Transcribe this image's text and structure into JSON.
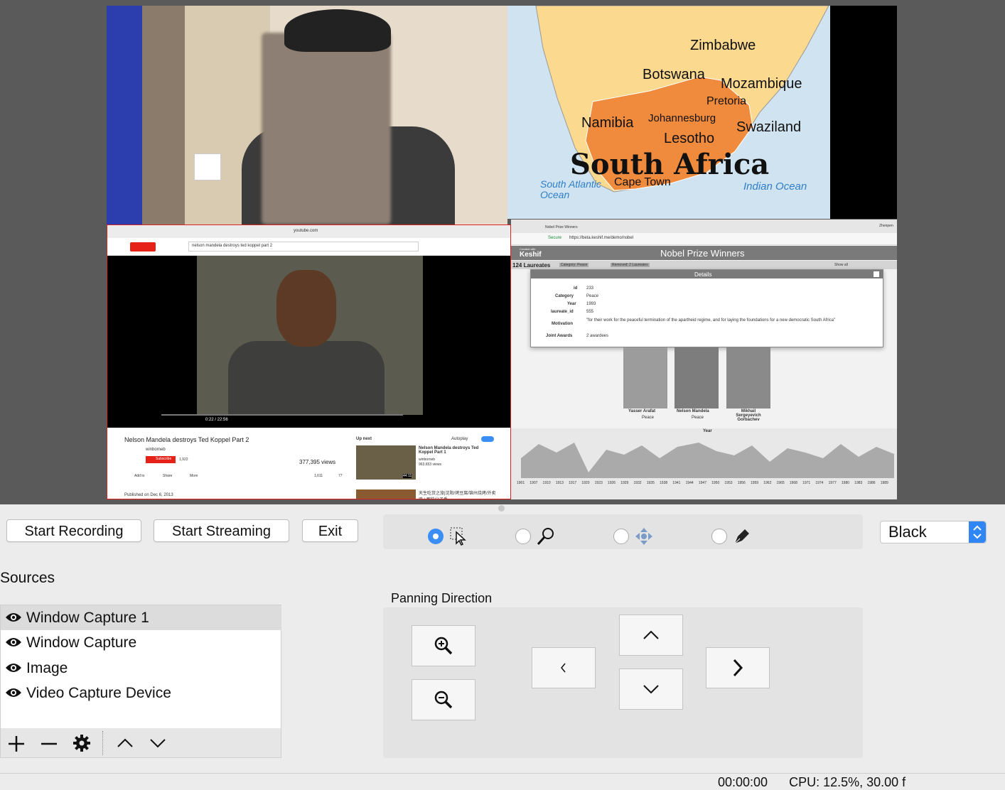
{
  "preview": {
    "map": {
      "countries": [
        "Zimbabwe",
        "Botswana",
        "Mozambique",
        "Pretoria",
        "Namibia",
        "Johannesburg",
        "Swaziland",
        "Lesotho"
      ],
      "title": "South Africa",
      "city": "Cape Town",
      "ocean_left": "South Atlantic Ocean",
      "ocean_right": "Indian Ocean"
    },
    "youtube": {
      "url": "youtube.com",
      "search": "nelson mandela destroys ted koppel part 2",
      "time": "0:22 / 22:56",
      "video_title": "Nelson Mandela destroys Ted Koppel Part 2",
      "channel": "winborneb",
      "subscribe": "Subscribe",
      "subs": "1,922",
      "views": "377,395 views",
      "add_to": "Add to",
      "share": "Share",
      "more": "More",
      "likes": "1,611",
      "dislikes": "77",
      "published": "Published on Dec 6, 2013",
      "up_next": "Up next",
      "autoplay": "Autoplay",
      "next_title": "Nelson Mandela destroys Ted Koppel Part 1",
      "next_channel": "winborneb",
      "next_views": "963,653 views",
      "next_duration": "44:11",
      "next2_title": "天生吃货之旅|沈阳/烤豆腐/锦州烧烤/外卖鸡 | 那些分子手"
    },
    "keshif": {
      "tab": "Nobel Prize Winners",
      "secure": "Secure",
      "url": "https://beta.keshif.me/demo/nobel",
      "user": "Zhenpen",
      "app_title": "Nobel Prize Winners",
      "logo_small": "Created with",
      "logo": "Keshif",
      "count": "124 Laureates",
      "filter1": "Category: Peace",
      "filter2": "Removed: 2 Laureates",
      "show_all": "Show all",
      "details_title": "Details",
      "details": [
        {
          "k": "id",
          "v": "233"
        },
        {
          "k": "Category",
          "v": "Peace"
        },
        {
          "k": "Year",
          "v": "1993"
        },
        {
          "k": "laureate_id",
          "v": "555"
        },
        {
          "k": "Motivation",
          "v": "\"for their work for the peaceful termination of the apartheid regime, and for laying the foundations for a new democratic South Africa\""
        },
        {
          "k": "Joint Awards",
          "v": "2 awardees"
        }
      ],
      "laureates": [
        {
          "name": "Yasser Arafat",
          "cat": "Peace"
        },
        {
          "name": "Nelson Mandela",
          "cat": "Peace"
        },
        {
          "name": "Mikhail Sergeyevich Gorbachev",
          "cat": ""
        }
      ],
      "year_label": "Year",
      "years": [
        "1901",
        "1907",
        "1910",
        "1913",
        "1917",
        "1920",
        "1923",
        "1926",
        "1929",
        "1932",
        "1935",
        "1938",
        "1941",
        "1944",
        "1947",
        "1950",
        "1953",
        "1956",
        "1959",
        "1962",
        "1965",
        "1968",
        "1971",
        "1974",
        "1977",
        "1980",
        "1983",
        "1986",
        "1989"
      ]
    }
  },
  "controls": {
    "start_recording": "Start Recording",
    "start_streaming": "Start Streaming",
    "exit": "Exit",
    "tools": [
      "select-tool-icon",
      "zoom-tool-icon",
      "pan-tool-icon",
      "pen-tool-icon"
    ],
    "selected_tool": 0,
    "background_color": "Black"
  },
  "sources": {
    "label": "Sources",
    "items": [
      {
        "label": "Window Capture 1",
        "selected": true
      },
      {
        "label": "Window Capture",
        "selected": false
      },
      {
        "label": "Image",
        "selected": false
      },
      {
        "label": "Video Capture Device",
        "selected": false
      }
    ]
  },
  "panning": {
    "label": "Panning Direction"
  },
  "status": {
    "text": "00:00:00      CPU: 12.5%, 30.00 f"
  },
  "colors": {
    "accent": "#3a8ef6",
    "map_land": "#fbd98e",
    "map_sa": "#f08a3c",
    "youtube_red": "#e62117"
  }
}
